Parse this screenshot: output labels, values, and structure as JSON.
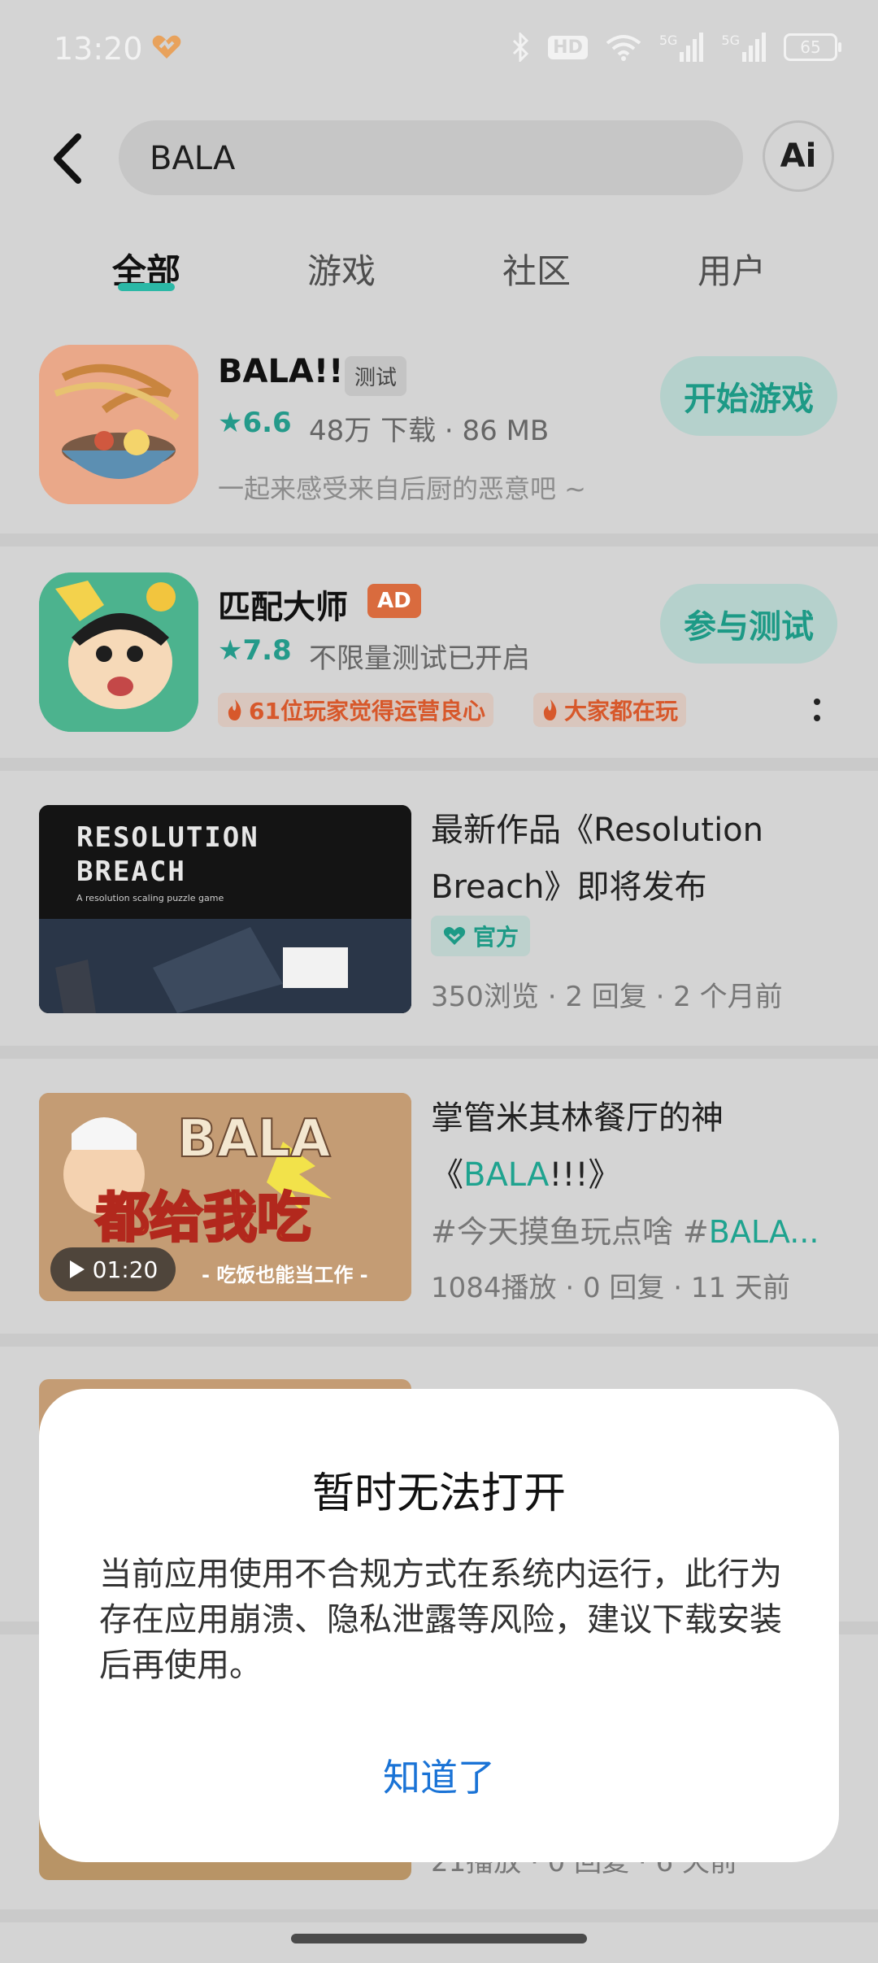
{
  "status_bar": {
    "time": "13:20",
    "battery": "65",
    "hd": "HD",
    "net1": "5G",
    "net2": "5G"
  },
  "search": {
    "query": "BALA",
    "ai_label": "Ai"
  },
  "tabs": [
    {
      "label": "全部",
      "active": true
    },
    {
      "label": "游戏",
      "active": false
    },
    {
      "label": "社区",
      "active": false
    },
    {
      "label": "用户",
      "active": false
    }
  ],
  "apps": [
    {
      "name": "BALA!!!",
      "tag": "测试",
      "rating": "6.6",
      "meta": "48万 下载 · 86 MB",
      "desc": "一起来感受来自后厨的恶意吧 ~",
      "action": "开始游戏"
    },
    {
      "name": "匹配大师",
      "tag": "AD",
      "rating": "7.8",
      "meta": "不限量测试已开启",
      "chips": [
        "61位玩家觉得运营良心",
        "大家都在玩"
      ],
      "action": "参与测试"
    }
  ],
  "posts": [
    {
      "title_a": "最新作品《Resolution",
      "title_b": "Breach》即将发布",
      "badge": "官方",
      "meta": "350浏览 · 2 回复 · 2 个月前",
      "thumb_text_1": "RESOLUTION",
      "thumb_text_2": "BREACH",
      "thumb_sub": "A resolution scaling puzzle game"
    },
    {
      "title_a": "掌管米其林餐厅的神",
      "title_b_pre": "《",
      "title_b_link": "BALA",
      "title_b_post": "!!!》",
      "hashtags_pre": "#今天摸鱼玩点啥 #",
      "hashtags_link": "BALA...",
      "meta": "1084播放 · 0 回复 · 11 天前",
      "duration": "01:20",
      "thumb_big": "都给我吃",
      "thumb_small": "- 吃饭也能当工作 -",
      "thumb_logo": "BALA"
    }
  ],
  "partial_meta": "21播放 · 0 回复 · 6 天前",
  "dialog": {
    "title": "暂时无法打开",
    "message": "当前应用使用不合规方式在系统内运行，此行为存在应用崩溃、隐私泄露等风险，建议下载安装后再使用。",
    "button": "知道了"
  }
}
